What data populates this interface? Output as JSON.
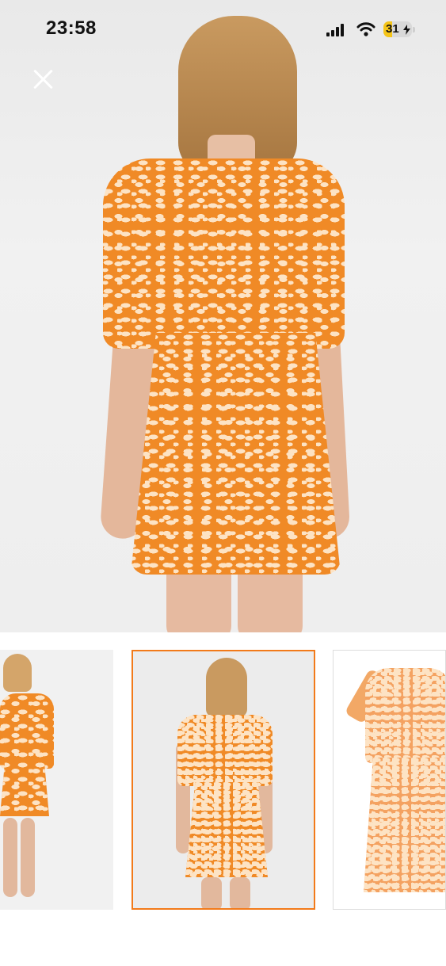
{
  "status_bar": {
    "time": "23:58",
    "battery_level": "31",
    "battery_fill_fraction": 0.31,
    "icons": [
      "cellular-signal-icon",
      "wifi-icon",
      "battery-charging-icon"
    ]
  },
  "viewer": {
    "close_icon": "close-icon",
    "main_image": "orange-print-dress-back-view",
    "accent_color": "#f27a1a"
  },
  "thumbnails": [
    {
      "image": "orange-print-dress-front-view",
      "selected": false
    },
    {
      "image": "orange-print-dress-back-view",
      "selected": true
    },
    {
      "image": "orange-print-dress-flat-product",
      "selected": false
    }
  ]
}
